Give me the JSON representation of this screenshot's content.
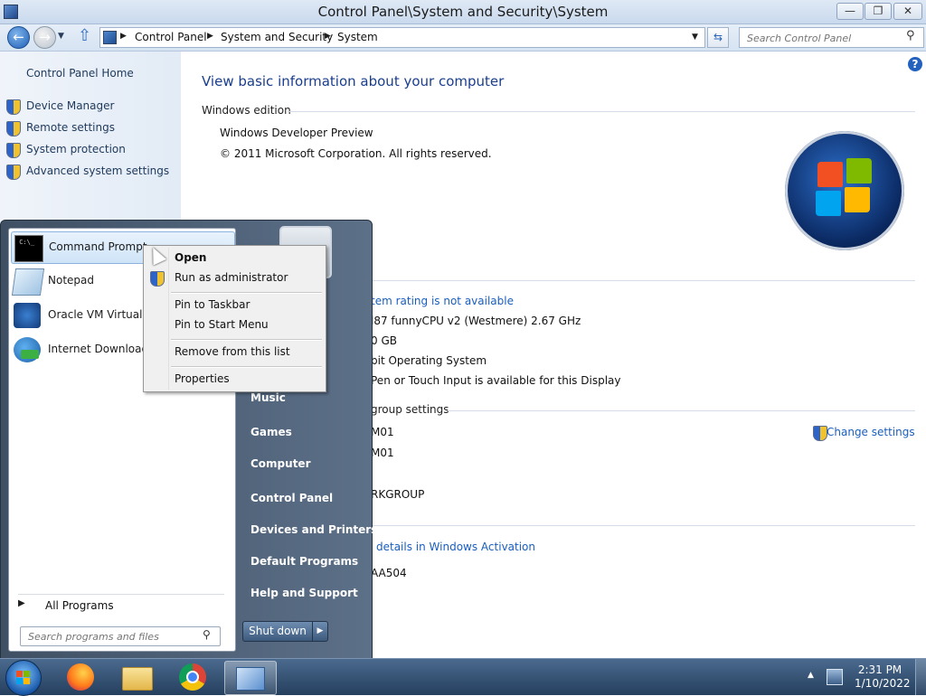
{
  "window": {
    "title": "Control Panel\\System and Security\\System",
    "minimize": "—",
    "maximize": "❐",
    "close": "✕"
  },
  "address": {
    "breadcrumbs": [
      "Control Panel",
      "System and Security",
      "System"
    ],
    "search_placeholder": "Search Control Panel"
  },
  "sidebar": {
    "home": "Control Panel Home",
    "items": [
      {
        "label": "Device Manager"
      },
      {
        "label": "Remote settings"
      },
      {
        "label": "System protection"
      },
      {
        "label": "Advanced system settings"
      }
    ]
  },
  "main": {
    "title": "View basic information about your computer",
    "edition_heading": "Windows edition",
    "edition_name": "Windows Developer Preview",
    "copyright": "© 2011 Microsoft Corporation. All rights reserved.",
    "rating_link": "tem rating is not available",
    "processor": "l87 funnyCPU v2 (Westmere)   2.67 GHz",
    "ram": "0 GB",
    "system_type": "bit Operating System",
    "pen_touch": "Pen or Touch Input is available for this Display",
    "workgroup_heading": "group settings",
    "change_settings": "Change settings",
    "computer_name": "M01",
    "full_name": "M01",
    "workgroup": "RKGROUP",
    "activation_link": "details in Windows Activation",
    "product_id": "AA504"
  },
  "start_menu": {
    "programs": [
      {
        "label": "Command Prompt"
      },
      {
        "label": "Notepad"
      },
      {
        "label": "Oracle VM VirtualBox"
      },
      {
        "label": "Internet Download Manager"
      }
    ],
    "right_items": [
      "Music",
      "Games",
      "Computer",
      "Control Panel",
      "Devices and Printers",
      "Default Programs",
      "Help and Support"
    ],
    "all_programs": "All Programs",
    "search_placeholder": "Search programs and files",
    "shutdown": "Shut down"
  },
  "context_menu": {
    "items": [
      "Open",
      "Run as administrator",
      "Pin to Taskbar",
      "Pin to Start Menu",
      "Remove from this list",
      "Properties"
    ]
  },
  "taskbar": {
    "time": "2:31 PM",
    "date": "1/10/2022"
  }
}
